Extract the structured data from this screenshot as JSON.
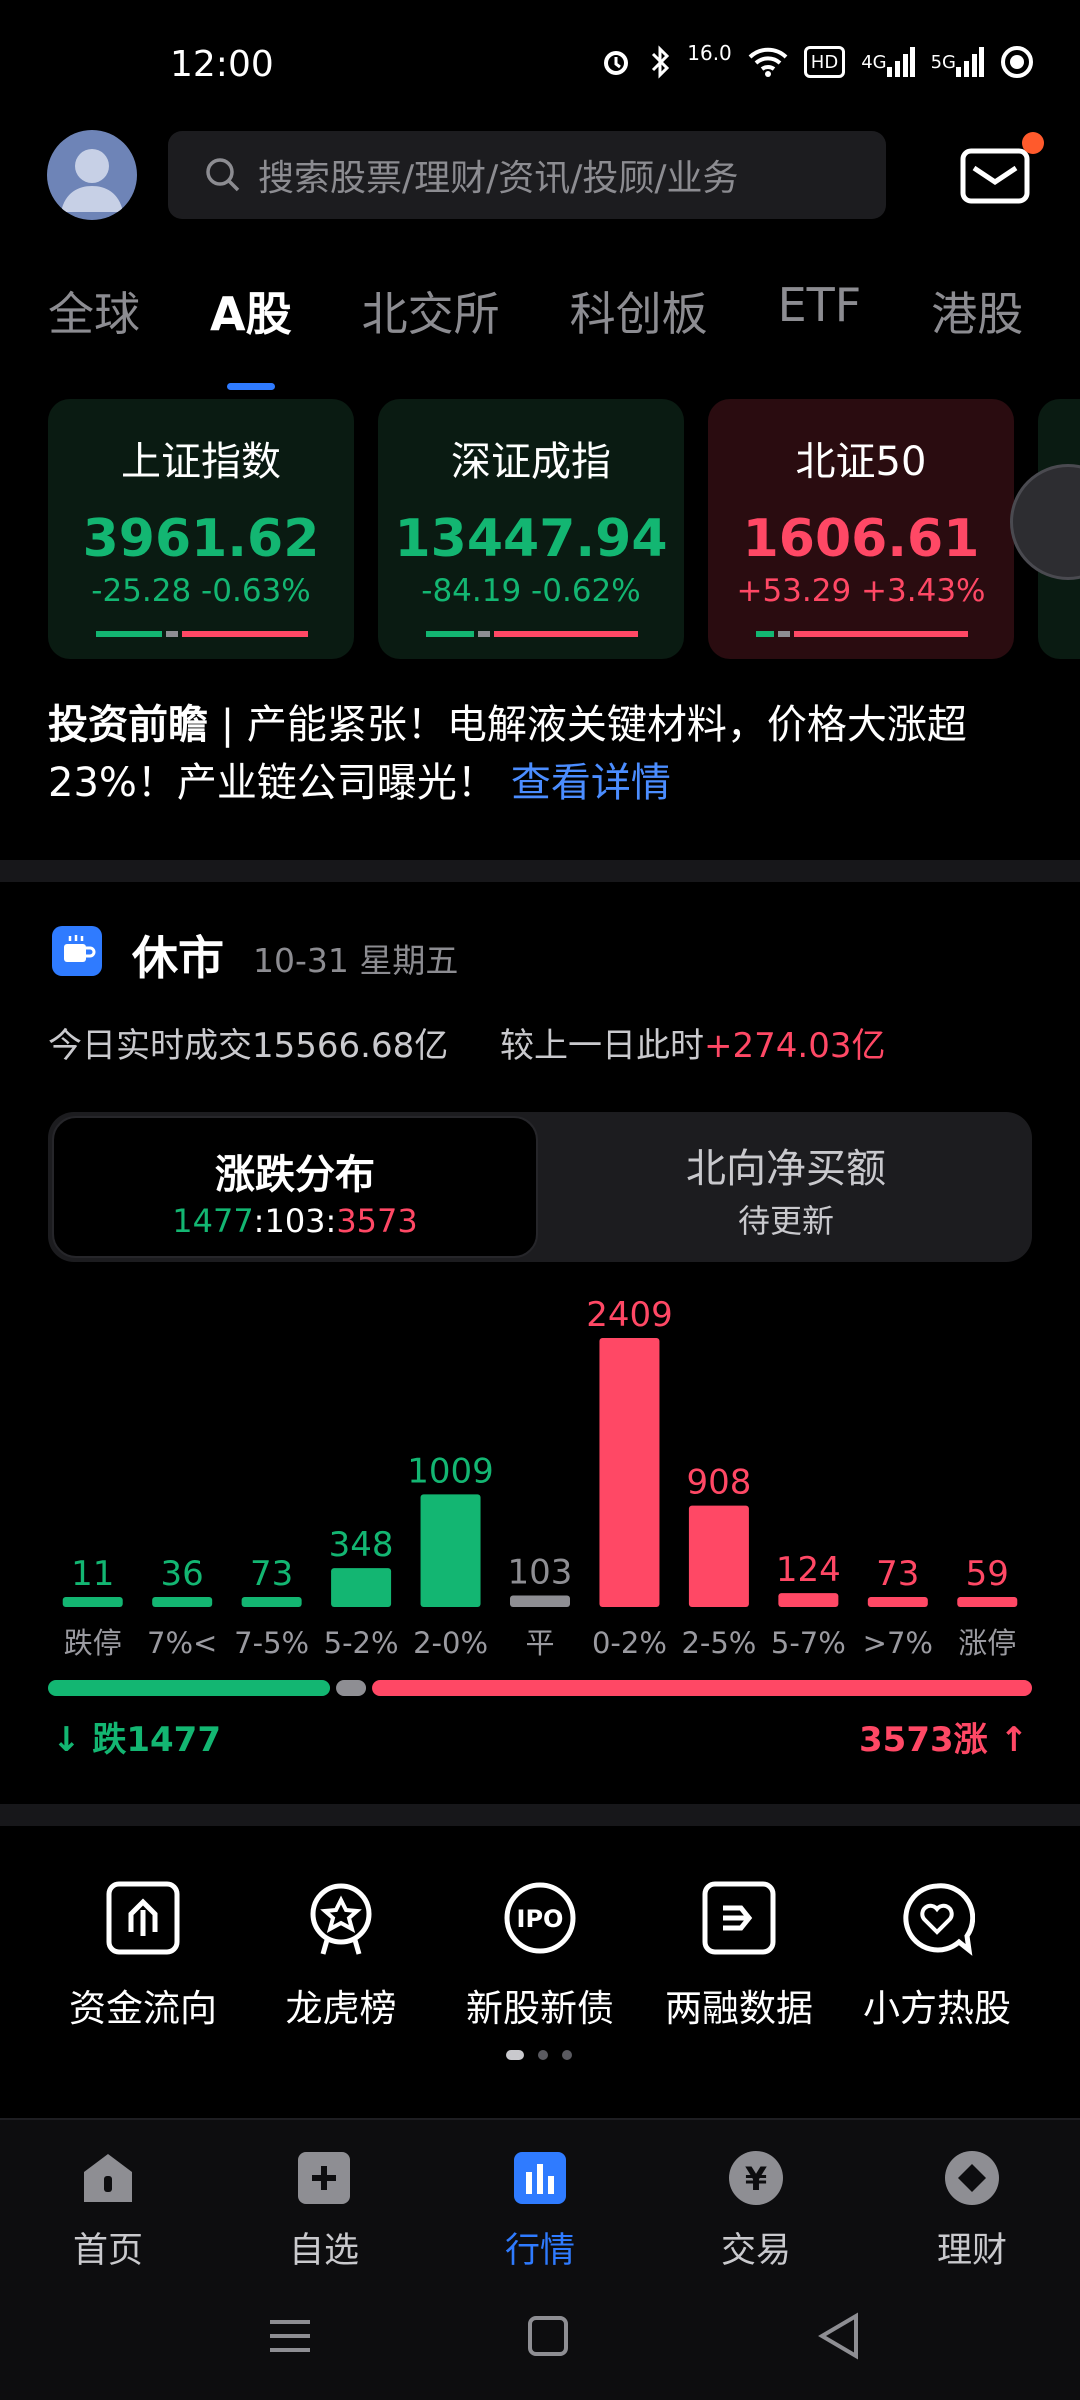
{
  "status_bar": {
    "time": "12:00",
    "network_speed": "16.0",
    "hd_badge": "HD",
    "signal_1": "4G",
    "signal_2": "5G"
  },
  "header": {
    "search_placeholder": "搜索股票/理财/资讯/投顾/业务"
  },
  "tabs": [
    "全球",
    "A股",
    "北交所",
    "科创板",
    "ETF",
    "港股"
  ],
  "active_tab": "A股",
  "index_cards": [
    {
      "name": "上证指数",
      "value": "3961.62",
      "change": "-25.28 -0.63%",
      "trend": "down"
    },
    {
      "name": "深证成指",
      "value": "13447.94",
      "change": "-84.19 -0.62%",
      "trend": "down"
    },
    {
      "name": "北证50",
      "value": "1606.61",
      "change": "+53.29 +3.43%",
      "trend": "up"
    }
  ],
  "news": {
    "tag": "投资前瞻",
    "separator": " | ",
    "text": "产能紧张！电解液关键材料，价格大涨超23%！产业链公司曝光！",
    "link": "查看详情"
  },
  "market": {
    "status": "休市",
    "date": "10-31 星期五",
    "turnover_label": "今日实时成交15566.68亿",
    "compare_label": "较上一日此时",
    "compare_value": "+274.03亿"
  },
  "segment": {
    "left_title": "涨跌分布",
    "left_down": "1477",
    "left_flat": "103",
    "left_up": "3573",
    "colon": ":",
    "right_title": "北向净买额",
    "right_sub": "待更新"
  },
  "chart_data": {
    "type": "bar",
    "categories": [
      "跌停",
      "7%<",
      "7-5%",
      "5-2%",
      "2-0%",
      "平",
      "0-2%",
      "2-5%",
      "5-7%",
      ">7%",
      "涨停"
    ],
    "values": [
      11,
      36,
      73,
      348,
      1009,
      103,
      2409,
      908,
      124,
      73,
      59
    ],
    "colors": [
      "#13b672",
      "#13b672",
      "#13b672",
      "#13b672",
      "#13b672",
      "#8e8e93",
      "#ff4865",
      "#ff4865",
      "#ff4865",
      "#ff4865",
      "#ff4865"
    ],
    "down_total": 1477,
    "flat_total": 103,
    "up_total": 3573
  },
  "totals": {
    "down_label": "跌1477",
    "up_label": "3573涨"
  },
  "shortcuts": [
    {
      "label": "资金流向",
      "icon": "fund-flow-icon"
    },
    {
      "label": "龙虎榜",
      "icon": "dragon-tiger-icon"
    },
    {
      "label": "新股新债",
      "icon": "ipo-icon"
    },
    {
      "label": "两融数据",
      "icon": "margin-data-icon"
    },
    {
      "label": "小方热股",
      "icon": "hot-stock-icon"
    }
  ],
  "bottom_nav": [
    {
      "label": "首页",
      "icon": "home-icon"
    },
    {
      "label": "自选",
      "icon": "watchlist-icon"
    },
    {
      "label": "行情",
      "icon": "market-icon"
    },
    {
      "label": "交易",
      "icon": "trade-icon"
    },
    {
      "label": "理财",
      "icon": "wealth-icon"
    }
  ],
  "colors": {
    "up": "#ff4865",
    "down": "#13b672",
    "flat": "#8e8e93",
    "accent": "#2f7bff",
    "link": "#4b8dff"
  }
}
